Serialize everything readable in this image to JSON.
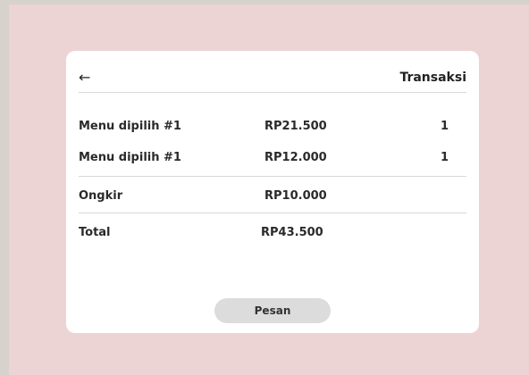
{
  "header": {
    "back_icon": "arrow-left-icon",
    "title": "Transaksi"
  },
  "items": [
    {
      "name": "Menu dipilih #1",
      "price": "RP21.500",
      "qty": "1"
    },
    {
      "name": "Menu dipilih #1",
      "price": "RP12.000",
      "qty": "1"
    }
  ],
  "ongkir": {
    "label": "Ongkir",
    "value": "RP10.000"
  },
  "total": {
    "label": "Total",
    "value": "RP43.500"
  },
  "actions": {
    "order_label": "Pesan"
  }
}
